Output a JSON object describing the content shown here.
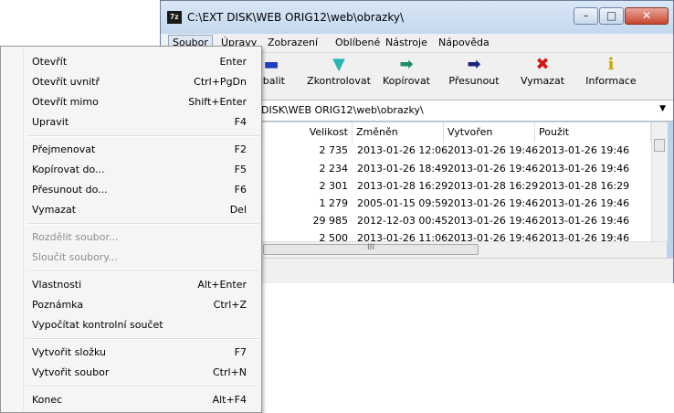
{
  "window": {
    "title": "C:\\EXT DISK\\WEB ORIG12\\web\\obrazky\\",
    "icon_label": "7z",
    "min_glyph": "–",
    "max_glyph": "□",
    "close_glyph": "✕"
  },
  "menubar": [
    "Soubor",
    "Úpravy",
    "Zobrazení",
    "Oblíbené",
    "Nástroje",
    "Nápověda"
  ],
  "toolbar": [
    {
      "label": "zbalit",
      "icon": "minus-icon",
      "glyph": "▬",
      "color": "#1f3fbf"
    },
    {
      "label": "Zkontrolovat",
      "icon": "check-down-icon",
      "glyph": "▼",
      "color": "#2ab5b5"
    },
    {
      "label": "Kopírovat",
      "icon": "copy-arrow-icon",
      "glyph": "➡",
      "color": "#1e8a6e"
    },
    {
      "label": "Přesunout",
      "icon": "move-arrow-icon",
      "glyph": "➡",
      "color": "#1a237e"
    },
    {
      "label": "Vymazat",
      "icon": "delete-x-icon",
      "glyph": "✖",
      "color": "#d01818"
    },
    {
      "label": "Informace",
      "icon": "info-icon",
      "glyph": "i",
      "color": "#c9a400"
    }
  ],
  "address": {
    "value": "DISK\\WEB ORIG12\\web\\obrazky\\",
    "arrow": "▼"
  },
  "columns": [
    "Velikost",
    "Změněn",
    "Vytvořen",
    "Použit"
  ],
  "rows": [
    {
      "size": "2 735",
      "modified": "2013-01-26 12:06",
      "created": "2013-01-26 19:46",
      "accessed": "2013-01-26 19:46"
    },
    {
      "size": "2 234",
      "modified": "2013-01-26 18:49",
      "created": "2013-01-26 19:46",
      "accessed": "2013-01-26 19:46"
    },
    {
      "size": "2 301",
      "modified": "2013-01-28 16:29",
      "created": "2013-01-28 16:29",
      "accessed": "2013-01-28 16:29"
    },
    {
      "size": "1 279",
      "modified": "2005-01-15 09:59",
      "created": "2013-01-26 19:46",
      "accessed": "2013-01-26 19:46"
    },
    {
      "size": "29 985",
      "modified": "2012-12-03 00:45",
      "created": "2013-01-26 19:46",
      "accessed": "2013-01-26 19:46"
    },
    {
      "size": "2 500",
      "modified": "2013-01-26 11:06",
      "created": "2013-01-26 19:46",
      "accessed": "2013-01-26 19:46"
    }
  ],
  "scroll": {
    "grip": "III"
  },
  "context_menu": [
    {
      "label": "Otevřít",
      "key": "Enter",
      "enabled": true
    },
    {
      "label": "Otevřít uvnitř",
      "key": "Ctrl+PgDn",
      "enabled": true
    },
    {
      "label": "Otevřít mimo",
      "key": "Shift+Enter",
      "enabled": true
    },
    {
      "label": "Upravit",
      "key": "F4",
      "enabled": true
    },
    {
      "sep": true
    },
    {
      "label": "Přejmenovat",
      "key": "F2",
      "enabled": true
    },
    {
      "label": "Kopírovat do...",
      "key": "F5",
      "enabled": true
    },
    {
      "label": "Přesunout do...",
      "key": "F6",
      "enabled": true
    },
    {
      "label": "Vymazat",
      "key": "Del",
      "enabled": true
    },
    {
      "sep": true
    },
    {
      "label": "Rozdělit soubor...",
      "key": "",
      "enabled": false
    },
    {
      "label": "Sloučit soubory...",
      "key": "",
      "enabled": false
    },
    {
      "sep": true
    },
    {
      "label": "Vlastnosti",
      "key": "Alt+Enter",
      "enabled": true
    },
    {
      "label": "Poznámka",
      "key": "Ctrl+Z",
      "enabled": true
    },
    {
      "label": "Vypočítat kontrolní součet",
      "key": "",
      "enabled": true
    },
    {
      "sep": true
    },
    {
      "label": "Vytvořit složku",
      "key": "F7",
      "enabled": true
    },
    {
      "label": "Vytvořit soubor",
      "key": "Ctrl+N",
      "enabled": true
    },
    {
      "sep": true
    },
    {
      "label": "Konec",
      "key": "Alt+F4",
      "enabled": true
    }
  ]
}
